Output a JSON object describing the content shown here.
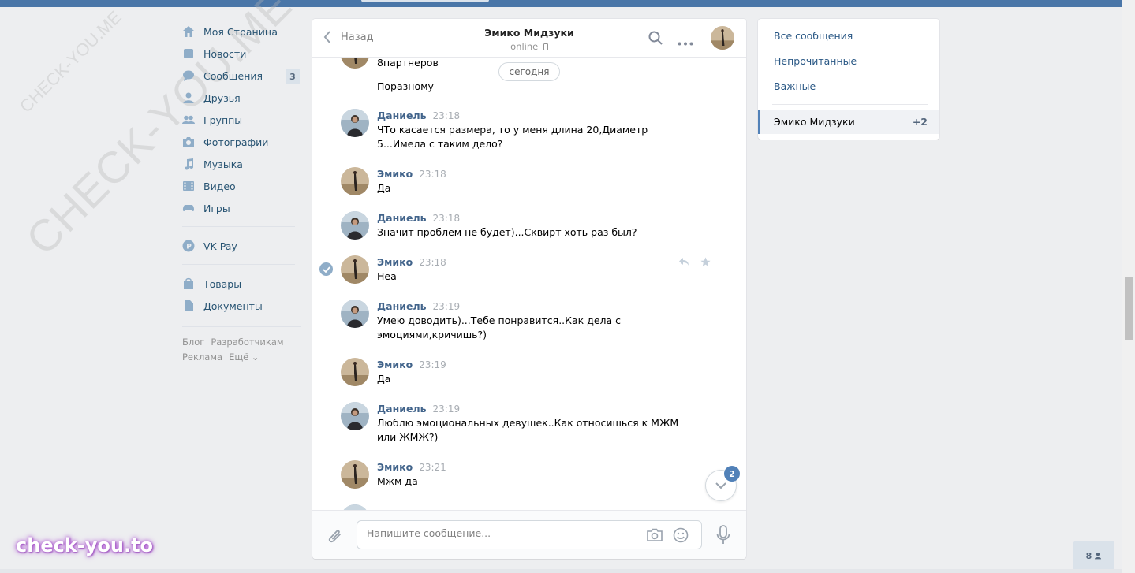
{
  "nav": {
    "items": [
      {
        "label": "Моя Страница",
        "icon": "home-icon"
      },
      {
        "label": "Новости",
        "icon": "news-icon"
      },
      {
        "label": "Сообщения",
        "icon": "message-icon",
        "badge": "3"
      },
      {
        "label": "Друзья",
        "icon": "user-icon"
      },
      {
        "label": "Группы",
        "icon": "group-icon"
      },
      {
        "label": "Фотографии",
        "icon": "camera-icon"
      },
      {
        "label": "Музыка",
        "icon": "music-icon"
      },
      {
        "label": "Видео",
        "icon": "video-icon"
      },
      {
        "label": "Игры",
        "icon": "gamepad-icon"
      }
    ],
    "vkpay": "VK Pay",
    "extra": [
      {
        "label": "Товары",
        "icon": "bag-icon"
      },
      {
        "label": "Документы",
        "icon": "document-icon"
      }
    ],
    "footer": [
      "Блог",
      "Разработчикам",
      "Реклама",
      "Ещё ⌄"
    ]
  },
  "chat": {
    "back_label": "Назад",
    "peer_name": "Эмико Мидзуки",
    "peer_status": "online",
    "date_pill": "сегодня",
    "previous_lines": [
      "8партнеров",
      "Поразному"
    ],
    "messages": [
      {
        "author": "Даниель",
        "time": "23:18",
        "text": "ЧТо касается размера, то у меня длина 20,Диаметр 5...Имела с таким дело?"
      },
      {
        "author": "Эмико",
        "time": "23:18",
        "text": "Да"
      },
      {
        "author": "Даниель",
        "time": "23:18",
        "text": "Значит проблем не будет)...Сквирт хоть раз был?"
      },
      {
        "author": "Эмико",
        "time": "23:18",
        "text": "Неа"
      },
      {
        "author": "Даниель",
        "time": "23:19",
        "text": "Умею доводить)...Тебе понравится..Как дела с эмоциями,кричишь?)"
      },
      {
        "author": "Эмико",
        "time": "23:19",
        "text": "Да"
      },
      {
        "author": "Даниель",
        "time": "23:19",
        "text": "Люблю эмоциональных девушек..Как относишься к МЖМ или ЖМЖ?)"
      },
      {
        "author": "Эмико",
        "time": "23:21",
        "text": "Мжм да"
      }
    ],
    "unread_badge": "2",
    "input_placeholder": "Напишите сообщение..."
  },
  "right": {
    "all": "Все сообщения",
    "unread": "Непрочитанные",
    "important": "Важные",
    "active_name": "Эмико Мидзуки",
    "active_count": "+2"
  },
  "watermark": {
    "small": "CHECK-YOU.ME",
    "large": "CHECK-YOU.ME"
  },
  "brand": "check-you.to",
  "friends_online": "8",
  "colors": {
    "accent": "#4a76a8",
    "link": "#2a5885",
    "author": "#42648b",
    "badge": "#5181b8"
  }
}
